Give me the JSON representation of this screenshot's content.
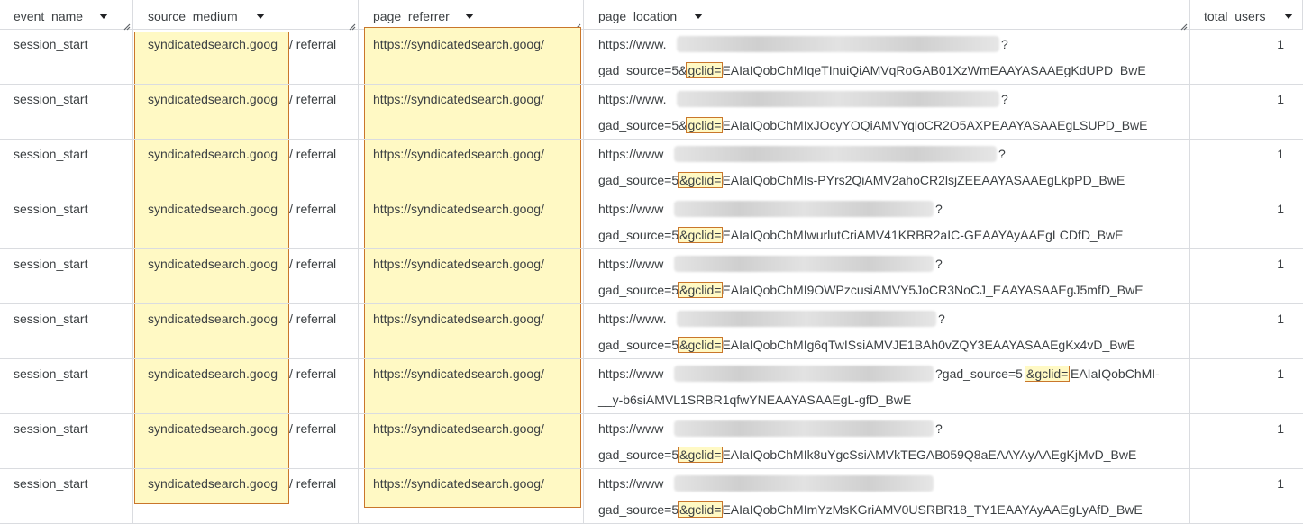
{
  "columns": [
    {
      "key": "event_name",
      "label": "event_name"
    },
    {
      "key": "source_medium",
      "label": "source_medium"
    },
    {
      "key": "page_referrer",
      "label": "page_referrer"
    },
    {
      "key": "page_location",
      "label": "page_location"
    },
    {
      "key": "total_users",
      "label": "total_users"
    }
  ],
  "rows": [
    {
      "event_name": "session_start",
      "source": "syndicatedsearch.goog",
      "medium": " / referral",
      "page_referrer": "https://syndicatedsearch.goog/",
      "loc_prefix": "https://www.",
      "loc_suffix": "?",
      "loc_line2_pre": "gad_source=5&",
      "gclid": "gclid=",
      "loc_line2_post": "EAIaIQobChMIqeTInuiQiAMVqRoGAB01XzWmEAAYASAAEgKdUPD_BwE",
      "total_users": "1"
    },
    {
      "event_name": "session_start",
      "source": "syndicatedsearch.goog",
      "medium": " / referral",
      "page_referrer": "https://syndicatedsearch.goog/",
      "loc_prefix": "https://www.",
      "loc_suffix": "?",
      "loc_line2_pre": "gad_source=5&",
      "gclid": "gclid=",
      "loc_line2_post": "EAIaIQobChMIxJOcyYOQiAMVYqloCR2O5AXPEAAYASAAEgLSUPD_BwE",
      "total_users": "1"
    },
    {
      "event_name": "session_start",
      "source": "syndicatedsearch.goog",
      "medium": " / referral",
      "page_referrer": "https://syndicatedsearch.goog/",
      "loc_prefix": "https://www",
      "loc_suffix": "?",
      "loc_line2_pre": "gad_source=5",
      "gclid": "&gclid=",
      "loc_line2_post": "EAIaIQobChMIs-PYrs2QiAMV2ahoCR2lsjZEEAAYASAAEgLkpPD_BwE",
      "total_users": "1"
    },
    {
      "event_name": "session_start",
      "source": "syndicatedsearch.goog",
      "medium": " / referral",
      "page_referrer": "https://syndicatedsearch.goog/",
      "loc_prefix": "https://www",
      "loc_suffix": "?",
      "loc_line2_pre": "gad_source=5",
      "gclid": "&gclid=",
      "loc_line2_post": "EAIaIQobChMIwurlutCriAMV41KRBR2aIC-GEAAYAyAAEgLCDfD_BwE",
      "total_users": "1"
    },
    {
      "event_name": "session_start",
      "source": "syndicatedsearch.goog",
      "medium": " / referral",
      "page_referrer": "https://syndicatedsearch.goog/",
      "loc_prefix": "https://www",
      "loc_suffix": "?",
      "loc_line2_pre": "gad_source=5",
      "gclid": "&gclid=",
      "loc_line2_post": "EAIaIQobChMI9OWPzcusiAMVY5JoCR3NoCJ_EAAYASAAEgJ5mfD_BwE",
      "total_users": "1"
    },
    {
      "event_name": "session_start",
      "source": "syndicatedsearch.goog",
      "medium": " / referral",
      "page_referrer": "https://syndicatedsearch.goog/",
      "loc_prefix": "https://www.",
      "loc_suffix": "?",
      "loc_line2_pre": "gad_source=5",
      "gclid": "&gclid=",
      "loc_line2_post": "EAIaIQobChMIg6qTwISsiAMVJE1BAh0vZQY3EAAYASAAEgKx4vD_BwE",
      "total_users": "1"
    },
    {
      "event_name": "session_start",
      "source": "syndicatedsearch.goog",
      "medium": " / referral",
      "page_referrer": "https://syndicatedsearch.goog/",
      "loc_prefix": "https://www",
      "loc_suffix": "?gad_source=5",
      "gclid": "&gclid=",
      "loc_suffix_post": "EAIaIQobChMI-",
      "loc_line2_pre": "",
      "loc_line2_post": "__y-b6siAMVL1SRBR1qfwYNEAAYASAAEgL-gfD_BwE",
      "total_users": "1"
    },
    {
      "event_name": "session_start",
      "source": "syndicatedsearch.goog",
      "medium": " / referral",
      "page_referrer": "https://syndicatedsearch.goog/",
      "loc_prefix": "https://www",
      "loc_suffix": "?",
      "loc_line2_pre": "gad_source=5",
      "gclid": "&gclid=",
      "loc_line2_post": "EAIaIQobChMIk8uYgcSsiAMVkTEGAB059Q8aEAAYAyAAEgKjMvD_BwE",
      "total_users": "1"
    },
    {
      "event_name": "session_start",
      "source": "syndicatedsearch.goog",
      "medium": " / referral",
      "page_referrer": "https://syndicatedsearch.goog/",
      "loc_prefix": "https://www",
      "loc_suffix": "",
      "loc_line2_pre": "gad_source=5",
      "gclid": "&gclid=",
      "loc_line2_post": "EAIaIQobChMImYzMsKGriAMV0USRBR18_TY1EAAYAyAAEgLyAfD_BwE",
      "total_users": "1"
    }
  ],
  "icons": {
    "sort": "sort-down-icon",
    "resize": "resize-handle-icon"
  },
  "colors": {
    "highlight_fill": "#fff9c4",
    "highlight_border": "#c9762b",
    "grid_line": "#dadce0"
  }
}
